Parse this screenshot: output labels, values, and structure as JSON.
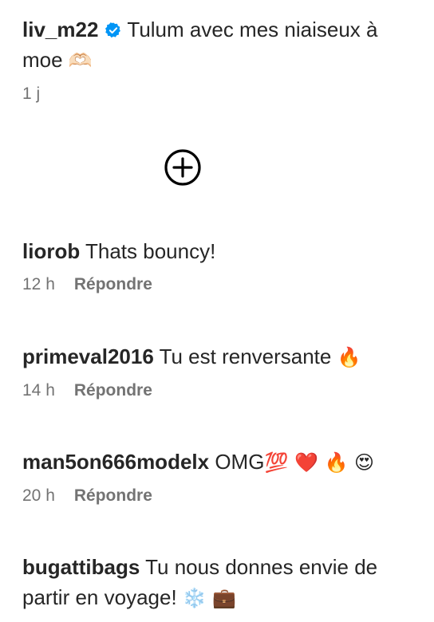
{
  "caption": {
    "username": "liv_m22",
    "text": "Tulum avec mes niaiseux à moe",
    "emoji": "🫶🏻",
    "time": "1 j",
    "verified_color": "#0095f6"
  },
  "add_button": {
    "icon": "plus-circle-icon"
  },
  "comments": [
    {
      "username": "liorob",
      "text": "Thats bouncy!",
      "emoji": "",
      "time": "12 h",
      "reply_label": "Répondre"
    },
    {
      "username": "primeval2016",
      "text": "Tu est renversante",
      "emoji": "🔥",
      "time": "14 h",
      "reply_label": "Répondre"
    },
    {
      "username": "man5on666modelx",
      "text": "OMG",
      "emoji": "💯 ❤️ 🔥 😍",
      "time": "20 h",
      "reply_label": "Répondre"
    },
    {
      "username": "bugattibags",
      "text": "Tu nous donnes envie de partir en voyage!",
      "emoji": "❄️ 💼",
      "time": "",
      "reply_label": ""
    }
  ]
}
